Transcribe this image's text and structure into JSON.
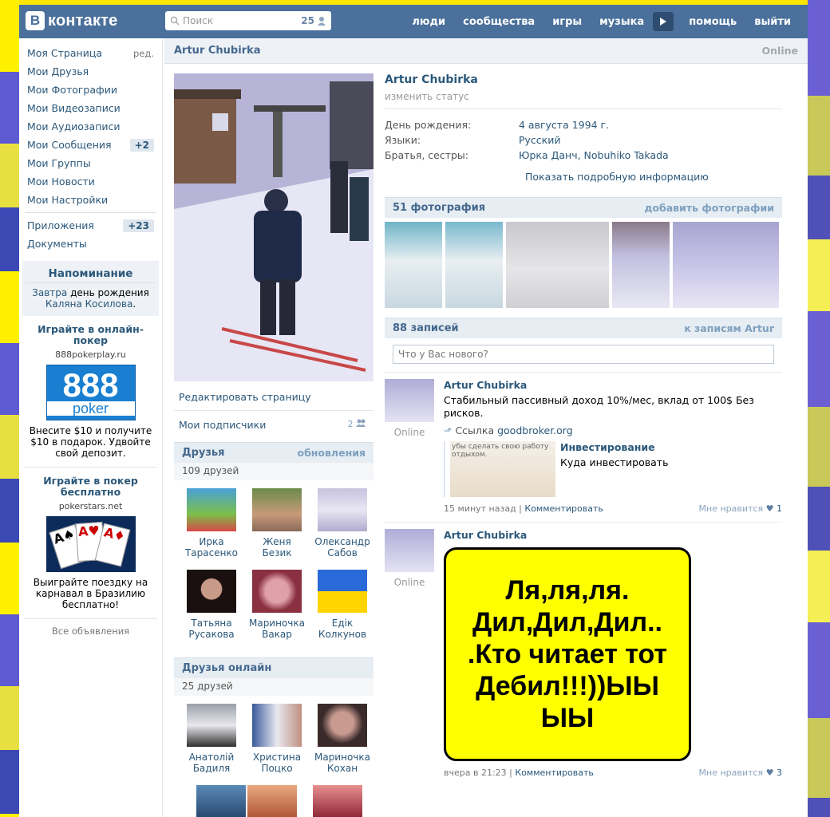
{
  "header": {
    "logo_b": "В",
    "logo_text": "контакте",
    "search_placeholder": "Поиск",
    "search_count": "25",
    "nav": [
      "люди",
      "сообщества",
      "игры",
      "музыка",
      "помощь",
      "выйти"
    ]
  },
  "sidebar": {
    "items": [
      {
        "label": "Моя Страница",
        "extra": "ред."
      },
      {
        "label": "Мои Друзья",
        "extra": ""
      },
      {
        "label": "Мои Фотографии",
        "extra": ""
      },
      {
        "label": "Мои Видеозаписи",
        "extra": ""
      },
      {
        "label": "Мои Аудиозаписи",
        "extra": ""
      },
      {
        "label": "Мои Сообщения",
        "extra": "+2"
      },
      {
        "label": "Мои Группы",
        "extra": ""
      },
      {
        "label": "Мои Новости",
        "extra": ""
      },
      {
        "label": "Мои Настройки",
        "extra": ""
      }
    ],
    "apps": "Приложения",
    "apps_count": "+23",
    "docs": "Документы"
  },
  "reminder": {
    "title": "Напоминание",
    "w1": "Завтра",
    "w2": "день рождения",
    "name": "Каляна Косилова",
    "dot": "."
  },
  "ads": [
    {
      "title": "Играйте в онлайн-покер",
      "url": "888pokerplay.ru",
      "img_num": "888",
      "img_word": "poker",
      "text": "Внесите $10 и получите $10 в подарок. Удвойте свой депозит."
    },
    {
      "title": "Играйте в покер бесплатно",
      "url": "pokerstars.net",
      "text": "Выиграйте поездку на карнавал в Бразилию бесплатно!"
    }
  ],
  "all_ads": "Все объявления",
  "profile": {
    "name": "Artur Chubirka",
    "online": "Online",
    "change_status": "изменить статус",
    "info": [
      {
        "k": "День рождения:",
        "v": "4 августа 1994 г."
      },
      {
        "k": "Языки:",
        "v": "Русский"
      },
      {
        "k": "Братья, сестры:",
        "v": "Юрка Данч, Nobuhiko Takada"
      }
    ],
    "more": "Показать подробную информацию"
  },
  "left_links": {
    "edit": "Редактировать страницу",
    "subs": "Мои подписчики",
    "subs_count": "2"
  },
  "friends": {
    "title": "Друзья",
    "updates": "обновления",
    "count": "109 друзей",
    "list": [
      {
        "n1": "Ирка",
        "n2": "Тарасенко"
      },
      {
        "n1": "Женя",
        "n2": "Безик"
      },
      {
        "n1": "Олександр",
        "n2": "Сабов"
      },
      {
        "n1": "Татьяна",
        "n2": "Русакова"
      },
      {
        "n1": "Мариночка",
        "n2": "Вакар"
      },
      {
        "n1": "Едік",
        "n2": "Колкунов"
      }
    ]
  },
  "friends_online": {
    "title": "Друзья онлайн",
    "count": "25 друзей",
    "list": [
      {
        "n1": "Анатолій",
        "n2": "Бадиля"
      },
      {
        "n1": "Христина",
        "n2": "Поцко"
      },
      {
        "n1": "Мариночка",
        "n2": "Кохан"
      }
    ]
  },
  "photos": {
    "title": "51 фотография",
    "add": "добавить фотографии"
  },
  "wall": {
    "title": "88 записей",
    "link": "к записям Artur",
    "placeholder": "Что у Вас нового?"
  },
  "posts": [
    {
      "author": "Artur Chubirka",
      "online": "Online",
      "text": "Стабильный пассивный доход 10%/мес, вклад от 100$ Без рисков.",
      "link_label": "Ссылка",
      "link": "goodbroker.org",
      "att_title": "Инвестирование",
      "att_sub": "Куда инвестировать",
      "att_img_text": "убы сделать свою работу отдыхом.",
      "time": "15 минут назад",
      "comment": "Комментировать",
      "like": "Мне нравится",
      "likes": "1"
    },
    {
      "author": "Artur Chubirka",
      "online": "Online",
      "image_text": "Ля,ля,ля. Дил,Дил,Дил.. .Кто читает тот Дебил!!!))ЫЫ ЫЫ",
      "time": "вчера в 21:23",
      "comment": "Комментировать",
      "like": "Мне нравится",
      "likes": "3"
    }
  ]
}
